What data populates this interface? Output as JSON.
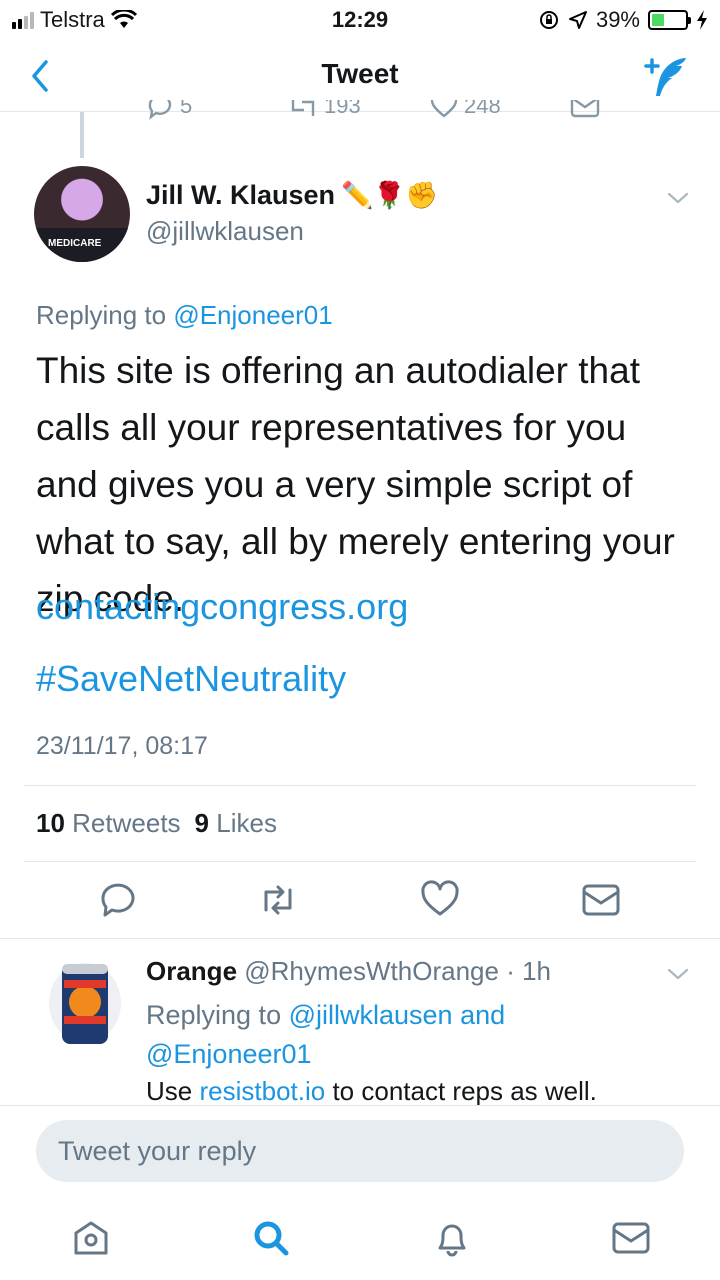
{
  "status_bar": {
    "carrier": "Telstra",
    "time": "12:29",
    "battery_pct": "39%",
    "battery_level": 0.39
  },
  "nav": {
    "title": "Tweet"
  },
  "prev_tweet_stats": {
    "replies": "5",
    "retweets": "193",
    "likes": "248"
  },
  "tweet": {
    "author_name": "Jill W. Klausen",
    "author_emojis": "✏️🌹✊",
    "author_handle": "@jillwklausen",
    "avatar_caption": "MEDICARE",
    "replying_prefix": "Replying to",
    "replying_to": "@Enjoneer01",
    "text": "This site is offering an autodialer that calls all your representatives for you and gives you a very simple script of what to say, all by merely entering your zip code.",
    "link": "contactingcongress.org",
    "hashtag": "#SaveNetNeutrality",
    "timestamp": "23/11/17, 08:17",
    "retweet_count": "10",
    "retweet_label": "Retweets",
    "like_count": "9",
    "like_label": "Likes"
  },
  "reply": {
    "author_name": "Orange",
    "author_handle": "@RhymesWthOrange",
    "time": "1h",
    "replying_prefix": "Replying to",
    "replying_to_1": "@jillwklausen",
    "replying_and": "and",
    "replying_to_2": "@Enjoneer01",
    "text_before": "Use",
    "text_link": "resistbot.io",
    "text_after": "to contact reps as well."
  },
  "composer": {
    "placeholder": "Tweet your reply"
  },
  "colors": {
    "accent": "#1b95e0",
    "secondary_text": "#657786",
    "divider": "#e1e8ed"
  },
  "icons": [
    "back-icon",
    "compose-icon",
    "reply-icon",
    "retweet-icon",
    "like-icon",
    "dm-icon",
    "home-icon",
    "search-icon",
    "notifications-icon",
    "messages-icon"
  ]
}
